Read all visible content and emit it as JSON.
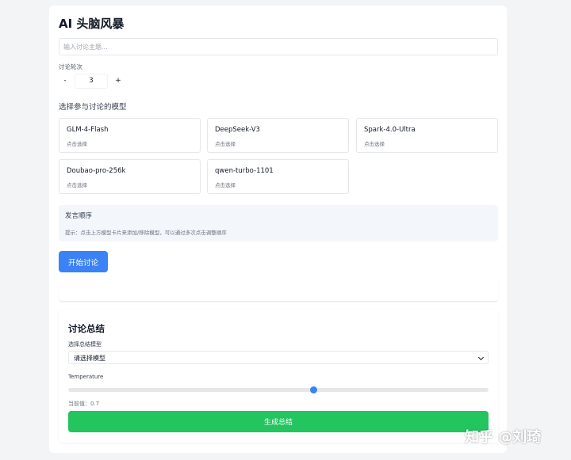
{
  "app": {
    "title": "AI 头脑风暴"
  },
  "topic": {
    "placeholder": "输入讨论主题...",
    "value": ""
  },
  "rounds": {
    "label": "讨论轮次",
    "value": "3",
    "minus_label": "-",
    "plus_label": "+"
  },
  "models": {
    "heading": "选择参与讨论的模型",
    "items": [
      {
        "name": "GLM-4-Flash",
        "hint": "点击选择"
      },
      {
        "name": "DeepSeek-V3",
        "hint": "点击选择"
      },
      {
        "name": "Spark-4.0-Ultra",
        "hint": "点击选择"
      },
      {
        "name": "Doubao-pro-256k",
        "hint": "点击选择"
      },
      {
        "name": "qwen-turbo-1101",
        "hint": "点击选择"
      }
    ]
  },
  "order": {
    "title": "发言顺序",
    "tip": "提示：点击上方模型卡片来添加/移除模型，可以通过多次点击调整顺序"
  },
  "actions": {
    "start_label": "开始讨论"
  },
  "summary": {
    "title": "讨论总结",
    "model_label": "选择总结模型",
    "model_select_value": "请选择模型",
    "temperature_label": "Temperature",
    "temperature_value_text": "当前值：0.7",
    "temperature": 0.7,
    "temperature_min": 0,
    "temperature_max": 1.2,
    "generate_label": "生成总结"
  },
  "watermark": {
    "text": "知乎 @刘琦"
  },
  "colors": {
    "accent_blue": "#3b82f6",
    "accent_green": "#22c55e",
    "page_bg": "#f3f4f6",
    "card_bg": "#ffffff"
  },
  "icons": {
    "select_chevron": "chevron-down-icon"
  }
}
